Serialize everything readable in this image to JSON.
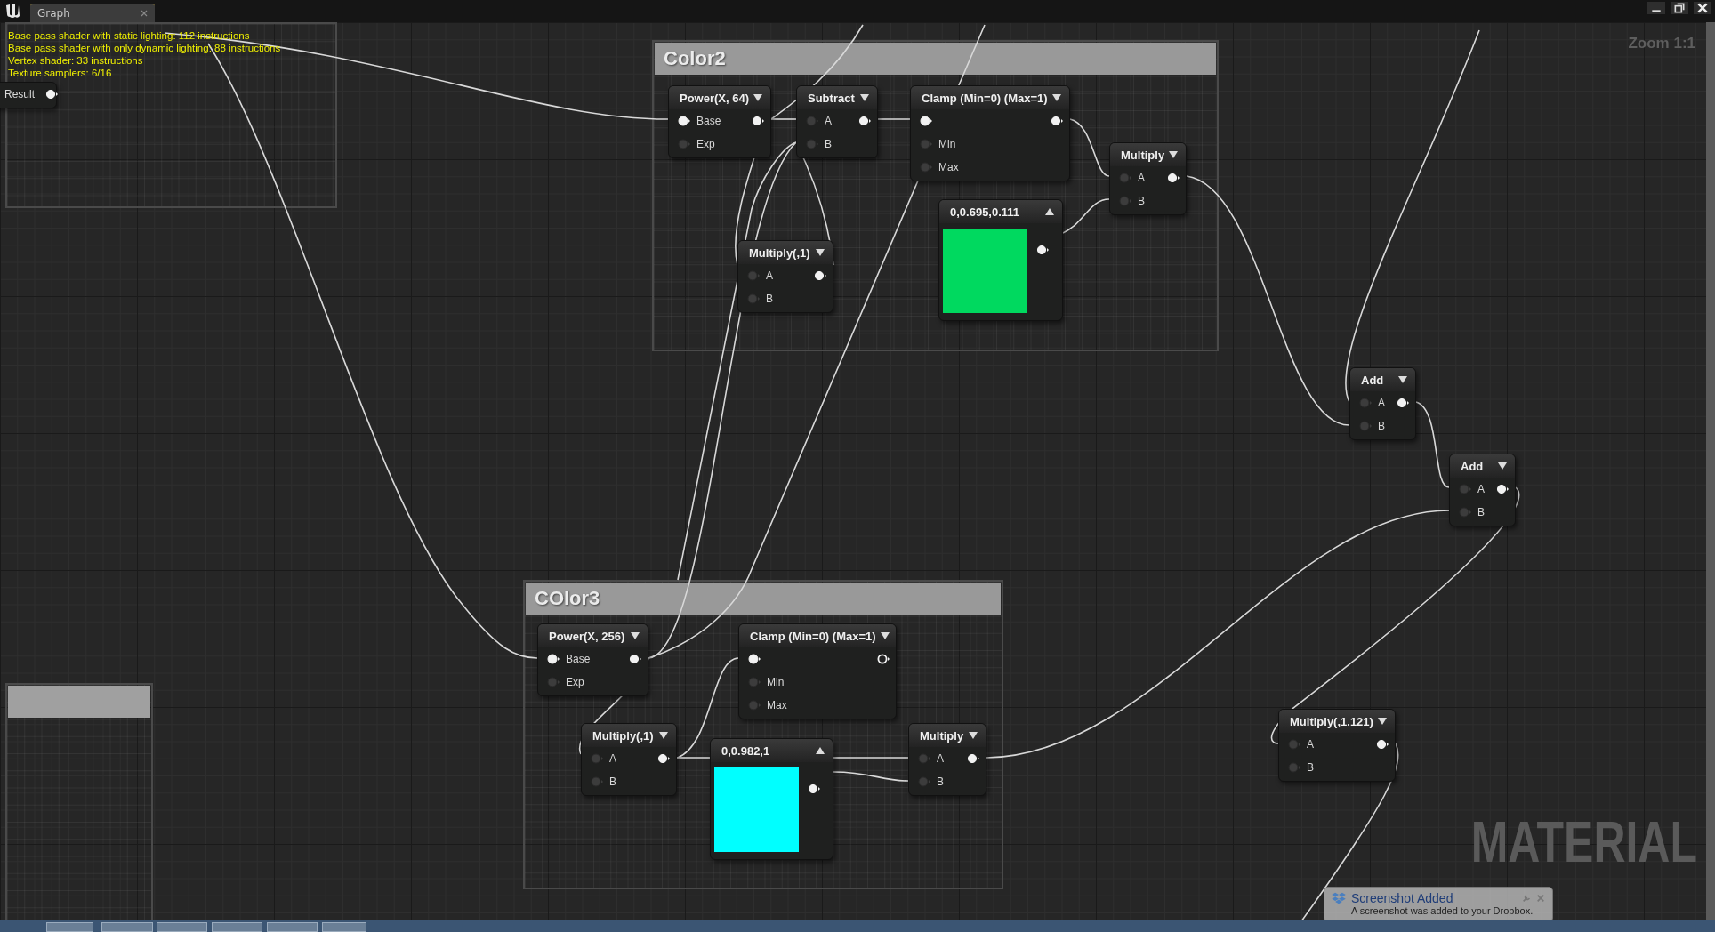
{
  "window": {
    "tab": "Graph"
  },
  "stats": [
    "Base pass shader with static lighting: 112 instructions",
    "Base pass shader with only dynamic lighting: 88 instructions",
    "Vertex shader: 33 instructions",
    "Texture samplers: 6/16"
  ],
  "zoom": "Zoom 1:1",
  "graph_type": "MATERIAL",
  "comments": [
    {
      "title": "Color2",
      "nodes": [
        {
          "kind": "expression",
          "title": "Power(X, 64)",
          "rows": [
            {
              "label": "Base",
              "in_linked": true,
              "out_linked": true
            },
            {
              "label": "Exp",
              "in_linked": false
            }
          ]
        },
        {
          "kind": "expression",
          "title": "Subtract",
          "rows": [
            {
              "label": "A",
              "in_linked": false,
              "out_linked": true
            },
            {
              "label": "B",
              "in_linked": false
            }
          ]
        },
        {
          "kind": "expression",
          "title": "Clamp (Min=0) (Max=1)",
          "rows": [
            {
              "in_linked": true,
              "out_linked": true
            },
            {
              "label": "Min",
              "in_linked": false
            },
            {
              "label": "Max",
              "in_linked": false
            }
          ]
        },
        {
          "kind": "expression",
          "title": "Multiply",
          "rows": [
            {
              "label": "A",
              "in_linked": false,
              "out_linked": true
            },
            {
              "label": "B",
              "in_linked": false
            }
          ]
        },
        {
          "kind": "expression",
          "title": "Multiply(,1)",
          "rows": [
            {
              "label": "A",
              "in_linked": false,
              "out_linked": true
            },
            {
              "label": "B",
              "in_linked": false
            }
          ]
        },
        {
          "kind": "constant",
          "title": "0,0.695,0.111",
          "color": "#00d95f",
          "out_linked": true
        }
      ]
    },
    {
      "title": "COlor3",
      "nodes": [
        {
          "kind": "expression",
          "title": "Power(X, 256)",
          "rows": [
            {
              "label": "Base",
              "in_linked": true,
              "out_linked": true
            },
            {
              "label": "Exp",
              "in_linked": false
            }
          ]
        },
        {
          "kind": "expression",
          "title": "Clamp (Min=0) (Max=1)",
          "rows": [
            {
              "in_linked": true,
              "out_linked": false
            },
            {
              "label": "Min",
              "in_linked": false
            },
            {
              "label": "Max",
              "in_linked": false
            }
          ]
        },
        {
          "kind": "expression",
          "title": "Multiply(,1)",
          "rows": [
            {
              "label": "A",
              "in_linked": false,
              "out_linked": true
            },
            {
              "label": "B",
              "in_linked": false
            }
          ]
        },
        {
          "kind": "constant",
          "title": "0,0.982,1",
          "color": "#00ffff",
          "out_linked": true
        },
        {
          "kind": "expression",
          "title": "Multiply",
          "rows": [
            {
              "label": "A",
              "in_linked": false,
              "out_linked": true
            },
            {
              "label": "B",
              "in_linked": false
            }
          ]
        }
      ]
    }
  ],
  "nodes": [
    {
      "kind": "expression",
      "title": "Add",
      "rows": [
        {
          "label": "A",
          "in_linked": false,
          "out_linked": true
        },
        {
          "label": "B",
          "in_linked": false
        }
      ]
    },
    {
      "kind": "expression",
      "title": "Add",
      "rows": [
        {
          "label": "A",
          "in_linked": false,
          "out_linked": true
        },
        {
          "label": "B",
          "in_linked": false
        }
      ]
    },
    {
      "kind": "expression",
      "title": "Multiply(,1.121)",
      "rows": [
        {
          "label": "A",
          "in_linked": false,
          "out_linked": true
        },
        {
          "label": "B",
          "in_linked": false
        }
      ]
    },
    {
      "kind": "fragment",
      "rows": [
        {
          "label": "Result",
          "out_linked": true
        }
      ]
    }
  ],
  "toast": {
    "title": "Screenshot Added",
    "message": "A screenshot was added to your Dropbox."
  }
}
